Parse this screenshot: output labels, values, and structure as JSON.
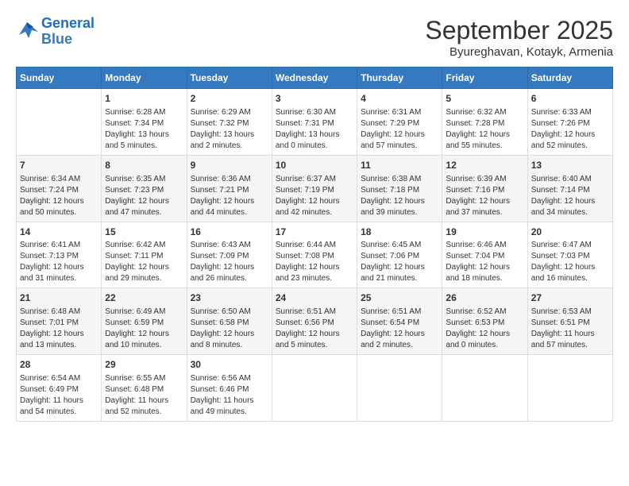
{
  "header": {
    "logo_line1": "General",
    "logo_line2": "Blue",
    "month": "September 2025",
    "location": "Byureghavan, Kotayk, Armenia"
  },
  "weekdays": [
    "Sunday",
    "Monday",
    "Tuesday",
    "Wednesday",
    "Thursday",
    "Friday",
    "Saturday"
  ],
  "weeks": [
    [
      {
        "day": "",
        "sunrise": "",
        "sunset": "",
        "daylight": ""
      },
      {
        "day": "1",
        "sunrise": "Sunrise: 6:28 AM",
        "sunset": "Sunset: 7:34 PM",
        "daylight": "Daylight: 13 hours and 5 minutes."
      },
      {
        "day": "2",
        "sunrise": "Sunrise: 6:29 AM",
        "sunset": "Sunset: 7:32 PM",
        "daylight": "Daylight: 13 hours and 2 minutes."
      },
      {
        "day": "3",
        "sunrise": "Sunrise: 6:30 AM",
        "sunset": "Sunset: 7:31 PM",
        "daylight": "Daylight: 13 hours and 0 minutes."
      },
      {
        "day": "4",
        "sunrise": "Sunrise: 6:31 AM",
        "sunset": "Sunset: 7:29 PM",
        "daylight": "Daylight: 12 hours and 57 minutes."
      },
      {
        "day": "5",
        "sunrise": "Sunrise: 6:32 AM",
        "sunset": "Sunset: 7:28 PM",
        "daylight": "Daylight: 12 hours and 55 minutes."
      },
      {
        "day": "6",
        "sunrise": "Sunrise: 6:33 AM",
        "sunset": "Sunset: 7:26 PM",
        "daylight": "Daylight: 12 hours and 52 minutes."
      }
    ],
    [
      {
        "day": "7",
        "sunrise": "Sunrise: 6:34 AM",
        "sunset": "Sunset: 7:24 PM",
        "daylight": "Daylight: 12 hours and 50 minutes."
      },
      {
        "day": "8",
        "sunrise": "Sunrise: 6:35 AM",
        "sunset": "Sunset: 7:23 PM",
        "daylight": "Daylight: 12 hours and 47 minutes."
      },
      {
        "day": "9",
        "sunrise": "Sunrise: 6:36 AM",
        "sunset": "Sunset: 7:21 PM",
        "daylight": "Daylight: 12 hours and 44 minutes."
      },
      {
        "day": "10",
        "sunrise": "Sunrise: 6:37 AM",
        "sunset": "Sunset: 7:19 PM",
        "daylight": "Daylight: 12 hours and 42 minutes."
      },
      {
        "day": "11",
        "sunrise": "Sunrise: 6:38 AM",
        "sunset": "Sunset: 7:18 PM",
        "daylight": "Daylight: 12 hours and 39 minutes."
      },
      {
        "day": "12",
        "sunrise": "Sunrise: 6:39 AM",
        "sunset": "Sunset: 7:16 PM",
        "daylight": "Daylight: 12 hours and 37 minutes."
      },
      {
        "day": "13",
        "sunrise": "Sunrise: 6:40 AM",
        "sunset": "Sunset: 7:14 PM",
        "daylight": "Daylight: 12 hours and 34 minutes."
      }
    ],
    [
      {
        "day": "14",
        "sunrise": "Sunrise: 6:41 AM",
        "sunset": "Sunset: 7:13 PM",
        "daylight": "Daylight: 12 hours and 31 minutes."
      },
      {
        "day": "15",
        "sunrise": "Sunrise: 6:42 AM",
        "sunset": "Sunset: 7:11 PM",
        "daylight": "Daylight: 12 hours and 29 minutes."
      },
      {
        "day": "16",
        "sunrise": "Sunrise: 6:43 AM",
        "sunset": "Sunset: 7:09 PM",
        "daylight": "Daylight: 12 hours and 26 minutes."
      },
      {
        "day": "17",
        "sunrise": "Sunrise: 6:44 AM",
        "sunset": "Sunset: 7:08 PM",
        "daylight": "Daylight: 12 hours and 23 minutes."
      },
      {
        "day": "18",
        "sunrise": "Sunrise: 6:45 AM",
        "sunset": "Sunset: 7:06 PM",
        "daylight": "Daylight: 12 hours and 21 minutes."
      },
      {
        "day": "19",
        "sunrise": "Sunrise: 6:46 AM",
        "sunset": "Sunset: 7:04 PM",
        "daylight": "Daylight: 12 hours and 18 minutes."
      },
      {
        "day": "20",
        "sunrise": "Sunrise: 6:47 AM",
        "sunset": "Sunset: 7:03 PM",
        "daylight": "Daylight: 12 hours and 16 minutes."
      }
    ],
    [
      {
        "day": "21",
        "sunrise": "Sunrise: 6:48 AM",
        "sunset": "Sunset: 7:01 PM",
        "daylight": "Daylight: 12 hours and 13 minutes."
      },
      {
        "day": "22",
        "sunrise": "Sunrise: 6:49 AM",
        "sunset": "Sunset: 6:59 PM",
        "daylight": "Daylight: 12 hours and 10 minutes."
      },
      {
        "day": "23",
        "sunrise": "Sunrise: 6:50 AM",
        "sunset": "Sunset: 6:58 PM",
        "daylight": "Daylight: 12 hours and 8 minutes."
      },
      {
        "day": "24",
        "sunrise": "Sunrise: 6:51 AM",
        "sunset": "Sunset: 6:56 PM",
        "daylight": "Daylight: 12 hours and 5 minutes."
      },
      {
        "day": "25",
        "sunrise": "Sunrise: 6:51 AM",
        "sunset": "Sunset: 6:54 PM",
        "daylight": "Daylight: 12 hours and 2 minutes."
      },
      {
        "day": "26",
        "sunrise": "Sunrise: 6:52 AM",
        "sunset": "Sunset: 6:53 PM",
        "daylight": "Daylight: 12 hours and 0 minutes."
      },
      {
        "day": "27",
        "sunrise": "Sunrise: 6:53 AM",
        "sunset": "Sunset: 6:51 PM",
        "daylight": "Daylight: 11 hours and 57 minutes."
      }
    ],
    [
      {
        "day": "28",
        "sunrise": "Sunrise: 6:54 AM",
        "sunset": "Sunset: 6:49 PM",
        "daylight": "Daylight: 11 hours and 54 minutes."
      },
      {
        "day": "29",
        "sunrise": "Sunrise: 6:55 AM",
        "sunset": "Sunset: 6:48 PM",
        "daylight": "Daylight: 11 hours and 52 minutes."
      },
      {
        "day": "30",
        "sunrise": "Sunrise: 6:56 AM",
        "sunset": "Sunset: 6:46 PM",
        "daylight": "Daylight: 11 hours and 49 minutes."
      },
      {
        "day": "",
        "sunrise": "",
        "sunset": "",
        "daylight": ""
      },
      {
        "day": "",
        "sunrise": "",
        "sunset": "",
        "daylight": ""
      },
      {
        "day": "",
        "sunrise": "",
        "sunset": "",
        "daylight": ""
      },
      {
        "day": "",
        "sunrise": "",
        "sunset": "",
        "daylight": ""
      }
    ]
  ]
}
